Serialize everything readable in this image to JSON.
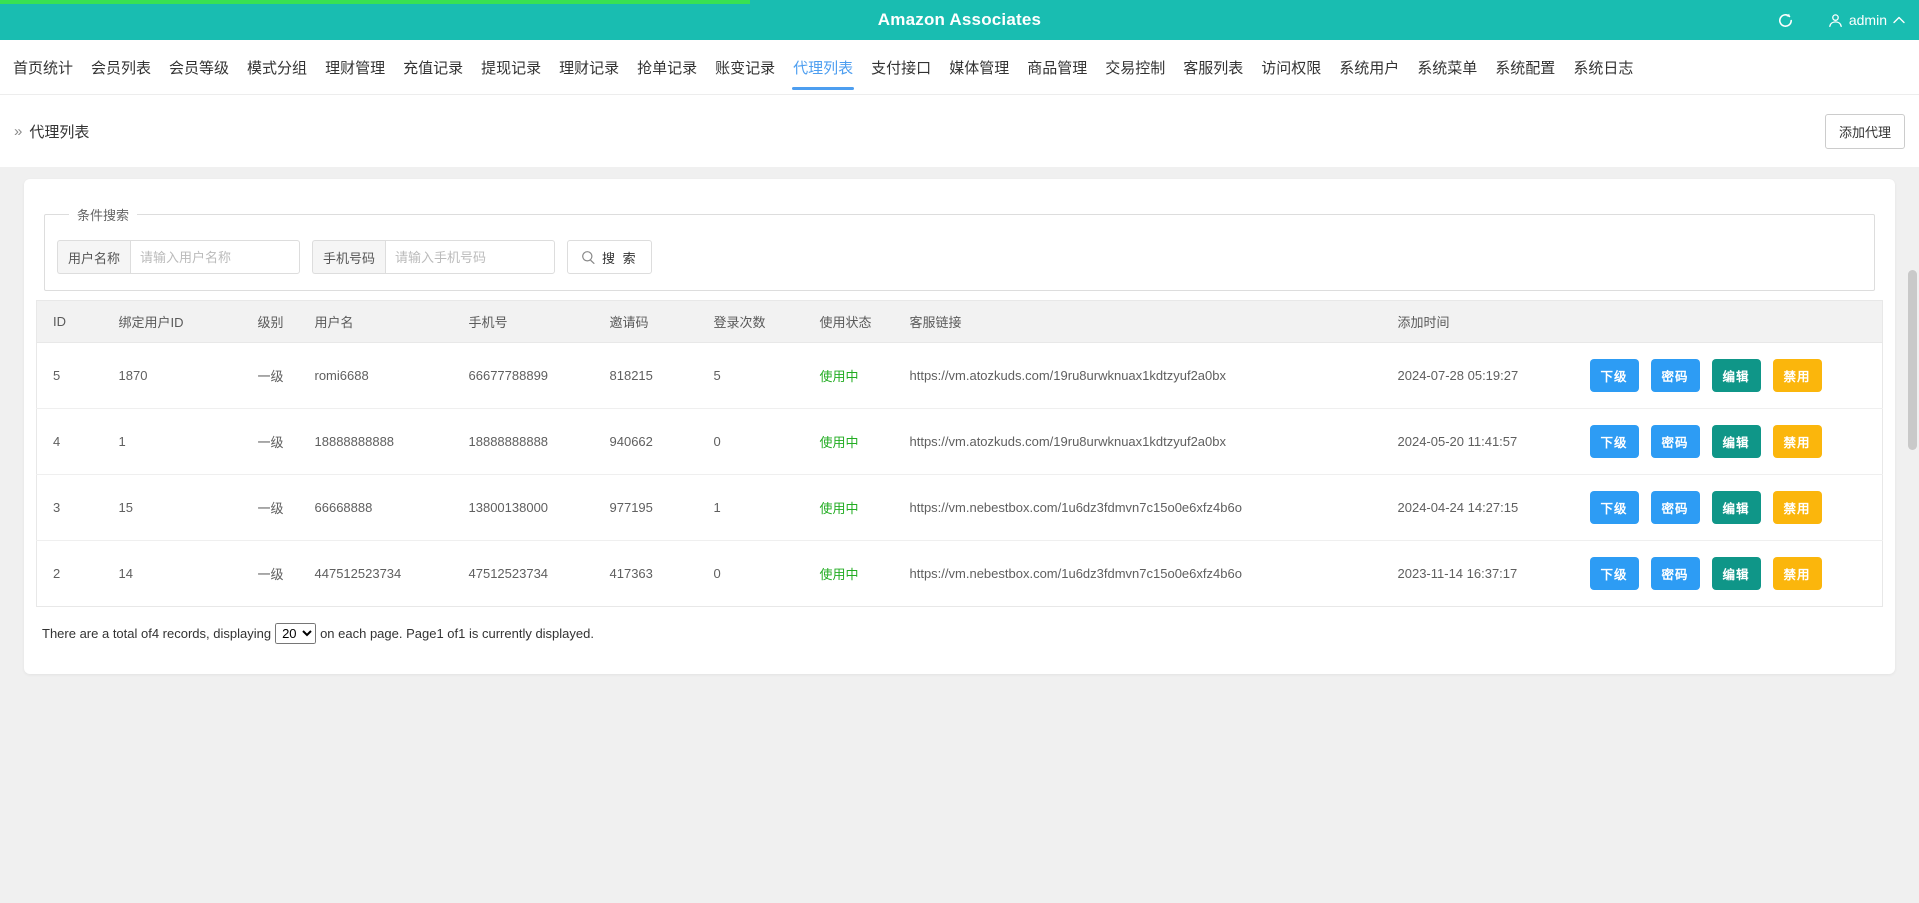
{
  "header": {
    "title": "Amazon Associates",
    "user": "admin"
  },
  "nav": {
    "items": [
      "首页统计",
      "会员列表",
      "会员等级",
      "模式分组",
      "理财管理",
      "充值记录",
      "提现记录",
      "理财记录",
      "抢单记录",
      "账变记录",
      "代理列表",
      "支付接口",
      "媒体管理",
      "商品管理",
      "交易控制",
      "客服列表",
      "访问权限",
      "系统用户",
      "系统菜单",
      "系统配置",
      "系统日志"
    ],
    "active_index": 10
  },
  "breadcrumb": {
    "arrow": "»",
    "label": "代理列表"
  },
  "toolbar": {
    "add_button": "添加代理"
  },
  "search": {
    "legend": "条件搜索",
    "fields": [
      {
        "label": "用户名称",
        "placeholder": "请输入用户名称"
      },
      {
        "label": "手机号码",
        "placeholder": "请输入手机号码"
      }
    ],
    "button_label": "搜 索"
  },
  "table": {
    "columns": [
      "ID",
      "绑定用户ID",
      "级别",
      "用户名",
      "手机号",
      "邀请码",
      "登录次数",
      "使用状态",
      "客服链接",
      "添加时间",
      ""
    ],
    "rows": [
      {
        "id": "5",
        "bind_id": "1870",
        "level": "一级",
        "username": "romi6688",
        "phone": "66677788899",
        "invite": "818215",
        "logins": "5",
        "status": "使用中",
        "link": "https://vm.atozkuds.com/19ru8urwknuax1kdtzyuf2a0bx",
        "time": "2024-07-28 05:19:27"
      },
      {
        "id": "4",
        "bind_id": "1",
        "level": "一级",
        "username": "18888888888",
        "phone": "18888888888",
        "invite": "940662",
        "logins": "0",
        "status": "使用中",
        "link": "https://vm.atozkuds.com/19ru8urwknuax1kdtzyuf2a0bx",
        "time": "2024-05-20 11:41:57"
      },
      {
        "id": "3",
        "bind_id": "15",
        "level": "一级",
        "username": "66668888",
        "phone": "13800138000",
        "invite": "977195",
        "logins": "1",
        "status": "使用中",
        "link": "https://vm.nebestbox.com/1u6dz3fdmvn7c15o0e6xfz4b6o",
        "time": "2024-04-24 14:27:15"
      },
      {
        "id": "2",
        "bind_id": "14",
        "level": "一级",
        "username": "447512523734",
        "phone": "47512523734",
        "invite": "417363",
        "logins": "0",
        "status": "使用中",
        "link": "https://vm.nebestbox.com/1u6dz3fdmvn7c15o0e6xfz4b6o",
        "time": "2023-11-14 16:37:17"
      }
    ],
    "actions": [
      "下级",
      "密码",
      "编辑",
      "禁用"
    ],
    "action_names": [
      "subordinate",
      "password",
      "edit",
      "disable"
    ]
  },
  "pagination": {
    "prefix": "There are a total of4 records, displaying",
    "page_size_options": [
      "20"
    ],
    "page_size": "20",
    "suffix": "on each page. Page1 of1 is currently displayed."
  },
  "colors": {
    "topbar_teal": "#19bdb1",
    "progress_green": "#38e153",
    "nav_active_blue": "#4d9ef0",
    "status_green": "#22ac22",
    "action_colors": [
      "#2d9cf4",
      "#2d9cf4",
      "#0f9688",
      "#fbb60c"
    ]
  }
}
